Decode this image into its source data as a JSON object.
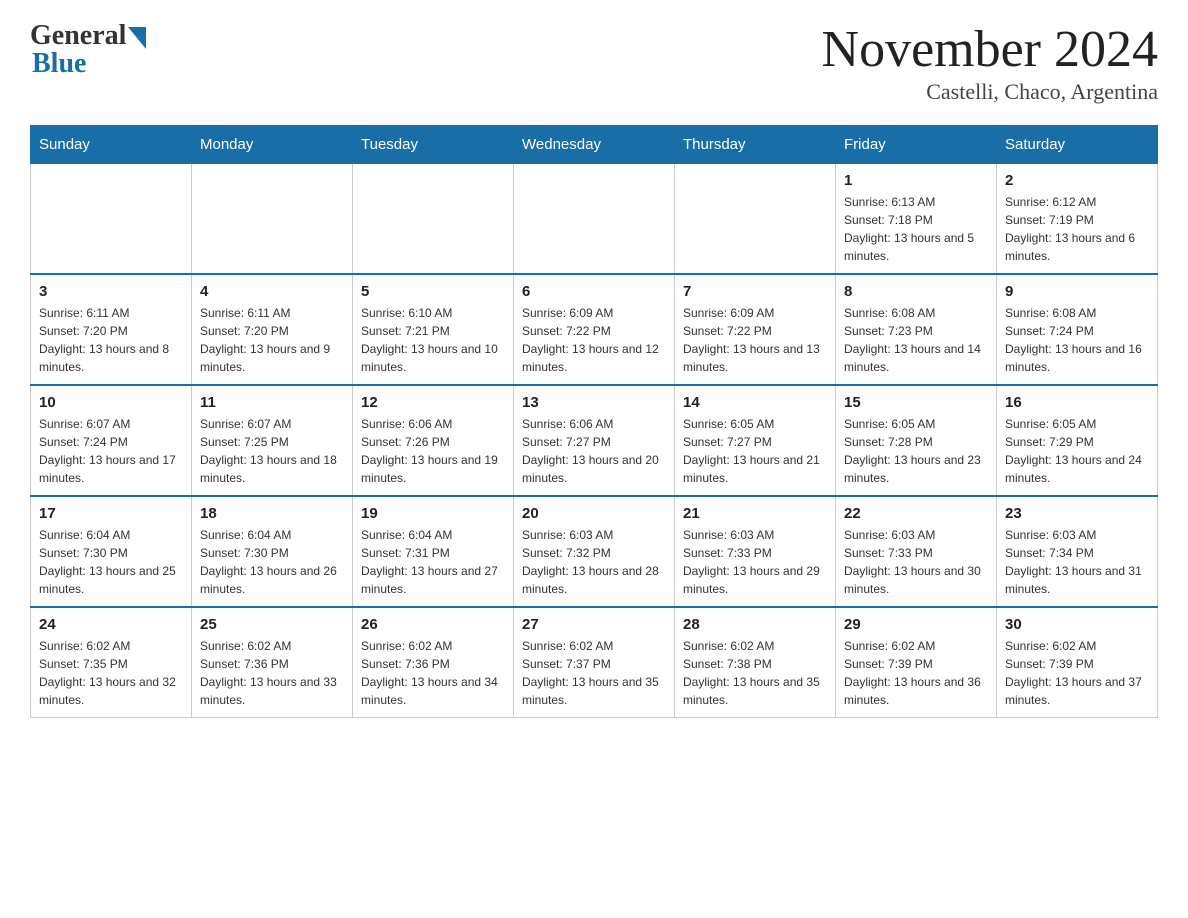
{
  "header": {
    "logo_general": "General",
    "logo_blue": "Blue",
    "month_title": "November 2024",
    "subtitle": "Castelli, Chaco, Argentina"
  },
  "weekdays": [
    "Sunday",
    "Monday",
    "Tuesday",
    "Wednesday",
    "Thursday",
    "Friday",
    "Saturday"
  ],
  "weeks": [
    [
      {
        "day": "",
        "sunrise": "",
        "sunset": "",
        "daylight": ""
      },
      {
        "day": "",
        "sunrise": "",
        "sunset": "",
        "daylight": ""
      },
      {
        "day": "",
        "sunrise": "",
        "sunset": "",
        "daylight": ""
      },
      {
        "day": "",
        "sunrise": "",
        "sunset": "",
        "daylight": ""
      },
      {
        "day": "",
        "sunrise": "",
        "sunset": "",
        "daylight": ""
      },
      {
        "day": "1",
        "sunrise": "Sunrise: 6:13 AM",
        "sunset": "Sunset: 7:18 PM",
        "daylight": "Daylight: 13 hours and 5 minutes."
      },
      {
        "day": "2",
        "sunrise": "Sunrise: 6:12 AM",
        "sunset": "Sunset: 7:19 PM",
        "daylight": "Daylight: 13 hours and 6 minutes."
      }
    ],
    [
      {
        "day": "3",
        "sunrise": "Sunrise: 6:11 AM",
        "sunset": "Sunset: 7:20 PM",
        "daylight": "Daylight: 13 hours and 8 minutes."
      },
      {
        "day": "4",
        "sunrise": "Sunrise: 6:11 AM",
        "sunset": "Sunset: 7:20 PM",
        "daylight": "Daylight: 13 hours and 9 minutes."
      },
      {
        "day": "5",
        "sunrise": "Sunrise: 6:10 AM",
        "sunset": "Sunset: 7:21 PM",
        "daylight": "Daylight: 13 hours and 10 minutes."
      },
      {
        "day": "6",
        "sunrise": "Sunrise: 6:09 AM",
        "sunset": "Sunset: 7:22 PM",
        "daylight": "Daylight: 13 hours and 12 minutes."
      },
      {
        "day": "7",
        "sunrise": "Sunrise: 6:09 AM",
        "sunset": "Sunset: 7:22 PM",
        "daylight": "Daylight: 13 hours and 13 minutes."
      },
      {
        "day": "8",
        "sunrise": "Sunrise: 6:08 AM",
        "sunset": "Sunset: 7:23 PM",
        "daylight": "Daylight: 13 hours and 14 minutes."
      },
      {
        "day": "9",
        "sunrise": "Sunrise: 6:08 AM",
        "sunset": "Sunset: 7:24 PM",
        "daylight": "Daylight: 13 hours and 16 minutes."
      }
    ],
    [
      {
        "day": "10",
        "sunrise": "Sunrise: 6:07 AM",
        "sunset": "Sunset: 7:24 PM",
        "daylight": "Daylight: 13 hours and 17 minutes."
      },
      {
        "day": "11",
        "sunrise": "Sunrise: 6:07 AM",
        "sunset": "Sunset: 7:25 PM",
        "daylight": "Daylight: 13 hours and 18 minutes."
      },
      {
        "day": "12",
        "sunrise": "Sunrise: 6:06 AM",
        "sunset": "Sunset: 7:26 PM",
        "daylight": "Daylight: 13 hours and 19 minutes."
      },
      {
        "day": "13",
        "sunrise": "Sunrise: 6:06 AM",
        "sunset": "Sunset: 7:27 PM",
        "daylight": "Daylight: 13 hours and 20 minutes."
      },
      {
        "day": "14",
        "sunrise": "Sunrise: 6:05 AM",
        "sunset": "Sunset: 7:27 PM",
        "daylight": "Daylight: 13 hours and 21 minutes."
      },
      {
        "day": "15",
        "sunrise": "Sunrise: 6:05 AM",
        "sunset": "Sunset: 7:28 PM",
        "daylight": "Daylight: 13 hours and 23 minutes."
      },
      {
        "day": "16",
        "sunrise": "Sunrise: 6:05 AM",
        "sunset": "Sunset: 7:29 PM",
        "daylight": "Daylight: 13 hours and 24 minutes."
      }
    ],
    [
      {
        "day": "17",
        "sunrise": "Sunrise: 6:04 AM",
        "sunset": "Sunset: 7:30 PM",
        "daylight": "Daylight: 13 hours and 25 minutes."
      },
      {
        "day": "18",
        "sunrise": "Sunrise: 6:04 AM",
        "sunset": "Sunset: 7:30 PM",
        "daylight": "Daylight: 13 hours and 26 minutes."
      },
      {
        "day": "19",
        "sunrise": "Sunrise: 6:04 AM",
        "sunset": "Sunset: 7:31 PM",
        "daylight": "Daylight: 13 hours and 27 minutes."
      },
      {
        "day": "20",
        "sunrise": "Sunrise: 6:03 AM",
        "sunset": "Sunset: 7:32 PM",
        "daylight": "Daylight: 13 hours and 28 minutes."
      },
      {
        "day": "21",
        "sunrise": "Sunrise: 6:03 AM",
        "sunset": "Sunset: 7:33 PM",
        "daylight": "Daylight: 13 hours and 29 minutes."
      },
      {
        "day": "22",
        "sunrise": "Sunrise: 6:03 AM",
        "sunset": "Sunset: 7:33 PM",
        "daylight": "Daylight: 13 hours and 30 minutes."
      },
      {
        "day": "23",
        "sunrise": "Sunrise: 6:03 AM",
        "sunset": "Sunset: 7:34 PM",
        "daylight": "Daylight: 13 hours and 31 minutes."
      }
    ],
    [
      {
        "day": "24",
        "sunrise": "Sunrise: 6:02 AM",
        "sunset": "Sunset: 7:35 PM",
        "daylight": "Daylight: 13 hours and 32 minutes."
      },
      {
        "day": "25",
        "sunrise": "Sunrise: 6:02 AM",
        "sunset": "Sunset: 7:36 PM",
        "daylight": "Daylight: 13 hours and 33 minutes."
      },
      {
        "day": "26",
        "sunrise": "Sunrise: 6:02 AM",
        "sunset": "Sunset: 7:36 PM",
        "daylight": "Daylight: 13 hours and 34 minutes."
      },
      {
        "day": "27",
        "sunrise": "Sunrise: 6:02 AM",
        "sunset": "Sunset: 7:37 PM",
        "daylight": "Daylight: 13 hours and 35 minutes."
      },
      {
        "day": "28",
        "sunrise": "Sunrise: 6:02 AM",
        "sunset": "Sunset: 7:38 PM",
        "daylight": "Daylight: 13 hours and 35 minutes."
      },
      {
        "day": "29",
        "sunrise": "Sunrise: 6:02 AM",
        "sunset": "Sunset: 7:39 PM",
        "daylight": "Daylight: 13 hours and 36 minutes."
      },
      {
        "day": "30",
        "sunrise": "Sunrise: 6:02 AM",
        "sunset": "Sunset: 7:39 PM",
        "daylight": "Daylight: 13 hours and 37 minutes."
      }
    ]
  ]
}
